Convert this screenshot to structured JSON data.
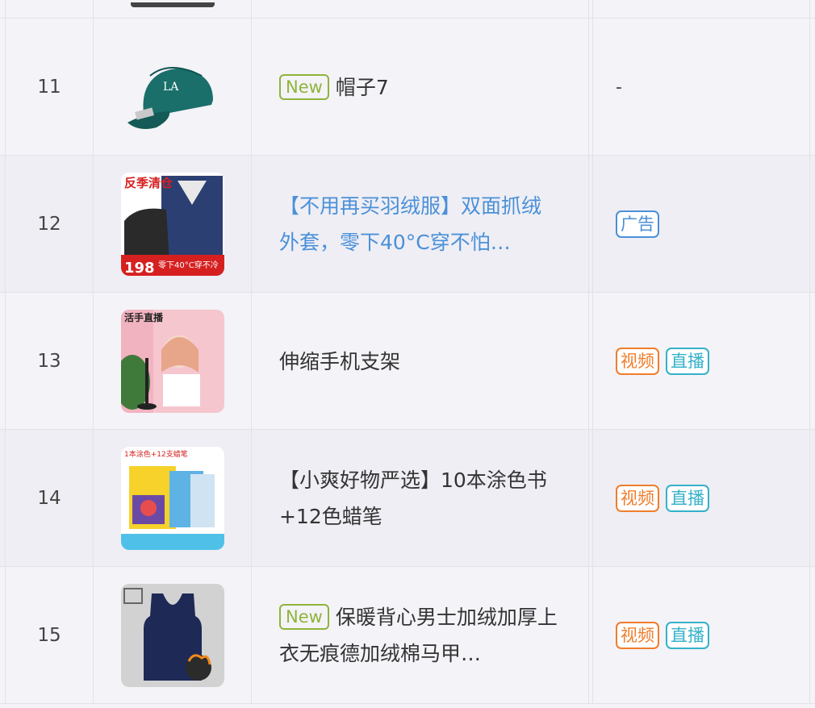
{
  "rows": [
    {
      "rank": "11",
      "new": "New",
      "title": "帽子7",
      "tags": [],
      "dash": "-",
      "thumb": "cap-image"
    },
    {
      "rank": "12",
      "new": "",
      "title": "【不用再买羽绒服】双面抓绒外套，零下40°C穿不怕…",
      "tags": [
        "广告"
      ],
      "thumb": "jacket-image"
    },
    {
      "rank": "13",
      "new": "",
      "title": "伸缩手机支架",
      "tags": [
        "视频",
        "直播"
      ],
      "thumb": "phone-stand-image"
    },
    {
      "rank": "14",
      "new": "",
      "title": "【小爽好物严选】10本涂色书+12色蜡笔",
      "tags": [
        "视频",
        "直播"
      ],
      "thumb": "coloring-book-image"
    },
    {
      "rank": "15",
      "new": "New",
      "title": "保暖背心男士加绒加厚上衣无痕德加绒棉马甲…",
      "tags": [
        "视频",
        "直播"
      ],
      "thumb": "vest-image"
    }
  ],
  "jacket_text": {
    "top": "反季清仓",
    "price": "198",
    "bottom": "零下40°C穿不冷"
  },
  "stand_text": {
    "top": "活手直播"
  },
  "book_text": {
    "top": "1本涂色+12支蜡笔"
  }
}
